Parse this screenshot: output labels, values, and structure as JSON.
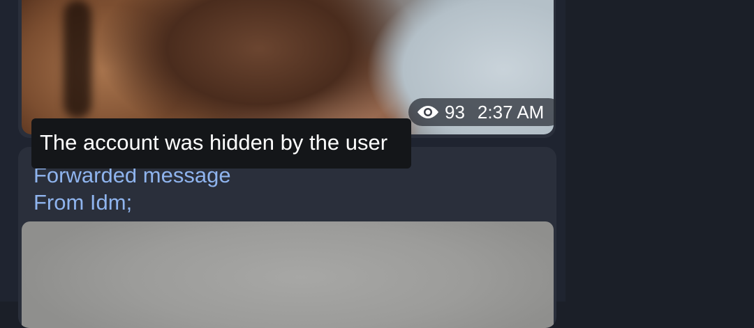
{
  "messages": [
    {
      "type": "photo",
      "views": "93",
      "time": "2:37 AM",
      "view_icon": "eye-icon"
    },
    {
      "type": "forwarded-photo",
      "forward_title": "Forwarded message",
      "forward_from": "From Idm;"
    }
  ],
  "tooltip": {
    "text": "The account was hidden by the user"
  },
  "colors": {
    "background": "#1b1f28",
    "bubble": "#2a2f3b",
    "link_text": "#8fb4ee",
    "tooltip_bg": "#141619"
  }
}
